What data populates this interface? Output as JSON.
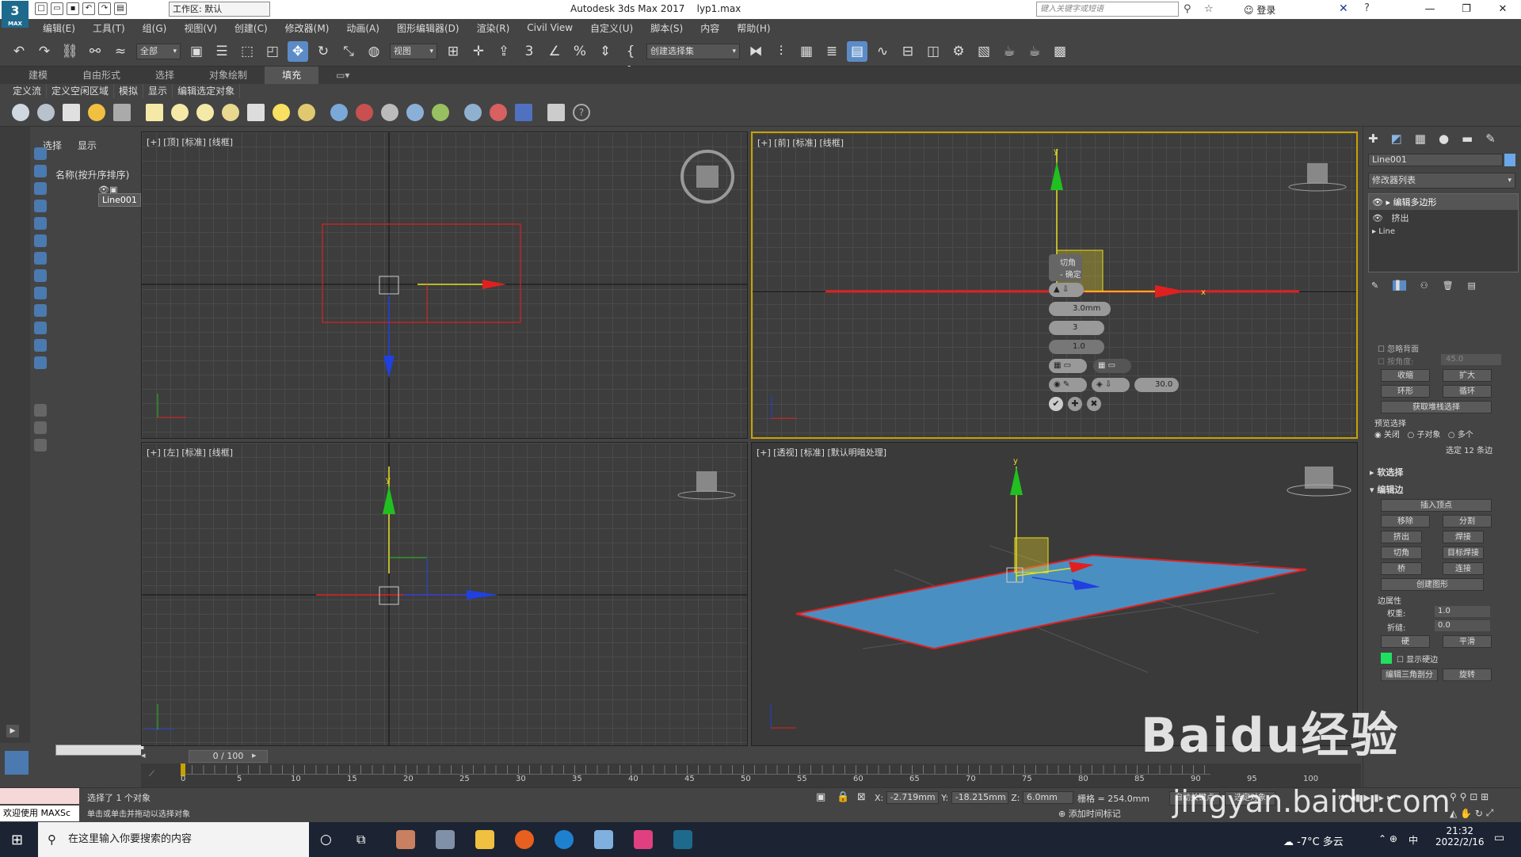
{
  "title_bar": {
    "workspace": "工作区: 默认",
    "app_title": "Autodesk 3ds Max 2017",
    "file_name": "lyp1.max",
    "search_placeholder": "键入关键字或短语",
    "login_label": "登录",
    "logo": "3",
    "logo_sub": "MAX"
  },
  "menu": [
    "编辑(E)",
    "工具(T)",
    "组(G)",
    "视图(V)",
    "创建(C)",
    "修改器(M)",
    "动画(A)",
    "图形编辑器(D)",
    "渲染(R)",
    "Civil View",
    "自定义(U)",
    "脚本(S)",
    "内容",
    "帮助(H)"
  ],
  "toolbar": {
    "filter_value": "全部",
    "coord_value": "视图",
    "selection_set": "创建选择集"
  },
  "ribbon": {
    "tabs": [
      "建模",
      "自由形式",
      "选择",
      "对象绘制",
      "填充"
    ],
    "active_tab": "填充",
    "sub": [
      "定义流",
      "定义空闲区域",
      "模拟",
      "显示",
      "编辑选定对象"
    ]
  },
  "scene_explorer": {
    "tabs": [
      "选择",
      "显示"
    ],
    "header": "名称(按升序排序)",
    "object": "Line001"
  },
  "viewports": {
    "top": "[+] [顶] [标准] [线框]",
    "front": "[+] [前] [标准] [线框]",
    "left": "[+] [左] [标准] [线框]",
    "persp": "[+] [透视] [标准] [默认明暗处理]"
  },
  "caddy": {
    "label_line1": "切角",
    "label_line2": "- 确定",
    "amount": "3.0mm",
    "segments": "3",
    "tension": "1.0",
    "angle": "30.0"
  },
  "command_panel": {
    "object_name": "Line001",
    "modifier_list": "修改器列表",
    "stack": [
      "编辑多边形",
      "挤出",
      "Line"
    ],
    "ignore_backfacing": "忽略背面",
    "angle_label": "按角度:",
    "angle_value": "45.0",
    "shrink": "收缩",
    "grow": "扩大",
    "ring": "环形",
    "loop": "循环",
    "get_stack_sel": "获取堆栈选择",
    "preview_sel": "预览选择",
    "preview_off": "关闭",
    "preview_sub": "子对象",
    "preview_multi": "多个",
    "selected_info": "选定 12 条边",
    "soft_sel": "软选择",
    "edit_edges": "编辑边",
    "insert_vertex": "插入顶点",
    "remove": "移除",
    "split": "分割",
    "extrude": "挤出",
    "weld": "焊接",
    "chamfer": "切角",
    "target_weld": "目标焊接",
    "bridge": "桥",
    "connect": "连接",
    "create_shape": "创建图形",
    "edge_props": "边属性",
    "weight_label": "权重:",
    "weight_value": "1.0",
    "crease_label": "折缝:",
    "crease_value": "0.0",
    "hard": "硬",
    "smooth": "平滑",
    "show_hard": "显示硬边",
    "edit_tri": "编辑三角剖分",
    "turn": "旋转"
  },
  "time_slider": {
    "label": "0 / 100"
  },
  "trackbar_ticks": [
    "0",
    "5",
    "10",
    "15",
    "20",
    "25",
    "30",
    "35",
    "40",
    "45",
    "50",
    "55",
    "60",
    "65",
    "70",
    "75",
    "80",
    "85",
    "90",
    "95",
    "100"
  ],
  "status": {
    "welcome": "欢迎使用 MAXSc",
    "line1": "选择了 1 个对象",
    "line2": "单击或单击并拖动以选择对象",
    "x_label": "X:",
    "x": "-2.719mm",
    "y_label": "Y:",
    "y": "-18.215mm",
    "z_label": "Z:",
    "z": "6.0mm",
    "grid": "栅格 = 254.0mm",
    "add_time_tag": "添加时间标记",
    "auto_key": "自动关键点",
    "set_key": "选定对象"
  },
  "taskbar": {
    "search_placeholder": "在这里输入你要搜索的内容",
    "weather": "-7°C 多云",
    "ime": "中",
    "time": "21:32",
    "date": "2022/2/16"
  },
  "watermark": {
    "main": "Baidu经验",
    "sub": "jingyan.baidu.com"
  },
  "colors": {
    "accent": "#5b8cc7",
    "active_border": "#c9a200",
    "plane": "#4a8fc2",
    "edge_red": "#e02020"
  }
}
